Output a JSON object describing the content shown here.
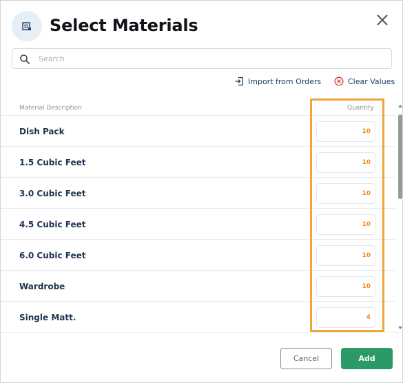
{
  "dialog": {
    "title": "Select Materials",
    "header_icon": "materials-icon",
    "close_icon": "close-icon"
  },
  "search": {
    "placeholder": "Search",
    "value": "",
    "icon": "search-icon"
  },
  "actions": {
    "import_label": "Import from Orders",
    "import_icon": "import-icon",
    "clear_label": "Clear Values",
    "clear_icon": "clear-circle-x-icon"
  },
  "table": {
    "columns": {
      "description": "Material Description",
      "quantity": "Quantity"
    },
    "rows": [
      {
        "label": "Dish Pack",
        "quantity": "10"
      },
      {
        "label": "1.5 Cubic Feet",
        "quantity": "10"
      },
      {
        "label": "3.0 Cubic Feet",
        "quantity": "10"
      },
      {
        "label": "4.5 Cubic Feet",
        "quantity": "10"
      },
      {
        "label": "6.0 Cubic Feet",
        "quantity": "10"
      },
      {
        "label": "Wardrobe",
        "quantity": "10"
      },
      {
        "label": "Single Matt.",
        "quantity": "4"
      }
    ]
  },
  "footer": {
    "cancel_label": "Cancel",
    "add_label": "Add"
  },
  "colors": {
    "accent_green": "#2b9a66",
    "quantity_orange": "#f08a24",
    "highlight_orange": "#f2a33a",
    "label_navy": "#1e3350"
  }
}
